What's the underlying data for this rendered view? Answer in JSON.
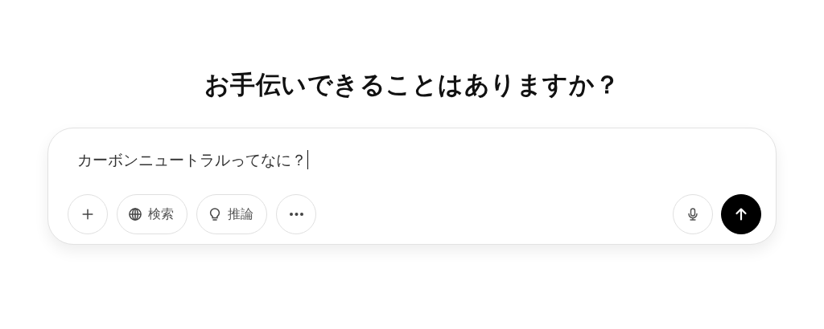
{
  "heading": "お手伝いできることはありますか？",
  "composer": {
    "value": "カーボンニュートラルってなに？",
    "tools": [
      {
        "kind": "plus"
      },
      {
        "kind": "search",
        "label": "検索"
      },
      {
        "kind": "reason",
        "label": "推論"
      },
      {
        "kind": "more"
      }
    ],
    "actions": [
      {
        "kind": "mic"
      },
      {
        "kind": "send"
      }
    ]
  }
}
